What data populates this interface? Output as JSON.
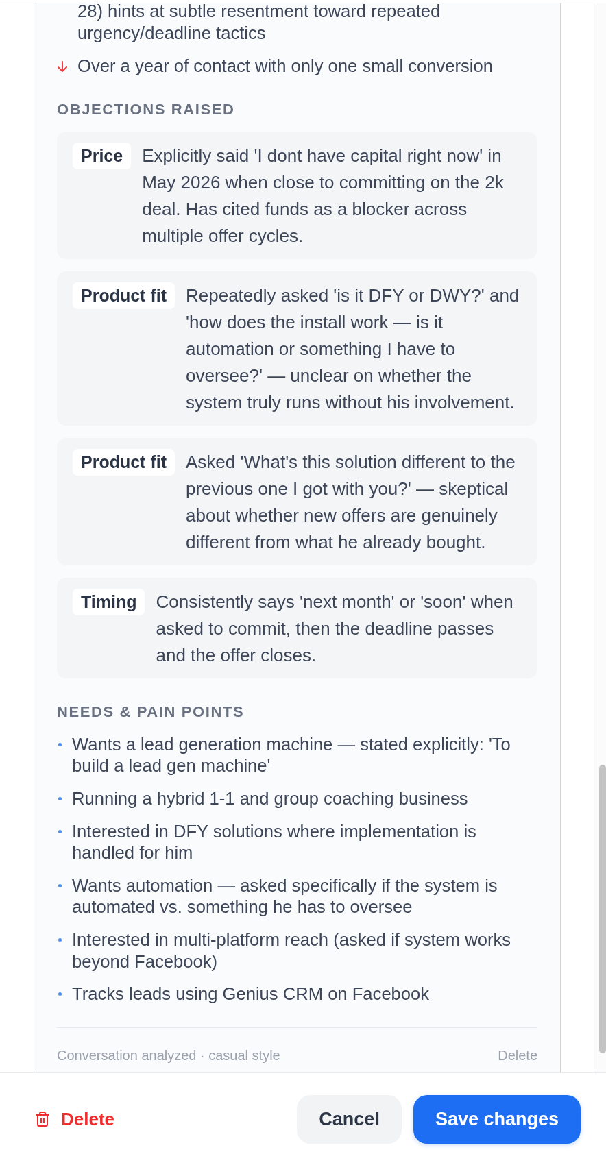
{
  "signals": [
    {
      "kind": "continued",
      "text": "28) hints at subtle resentment toward repeated urgency/deadline tactics"
    },
    {
      "kind": "negative",
      "text": "Over a year of contact with only one small conversion"
    }
  ],
  "objections": {
    "heading": "OBJECTIONS RAISED",
    "items": [
      {
        "label": "Price",
        "text": "Explicitly said 'I dont have capital right now' in May 2026 when close to committing on the 2k deal. Has cited funds as a blocker across multiple offer cycles."
      },
      {
        "label": "Product fit",
        "text": "Repeatedly asked 'is it DFY or DWY?' and 'how does the install work — is it automation or something I have to oversee?' — unclear on whether the system truly runs without his involvement."
      },
      {
        "label": "Product fit",
        "text": "Asked 'What's this solution different to the previous one I got with you?' — skeptical about whether new offers are genuinely different from what he already bought."
      },
      {
        "label": "Timing",
        "text": "Consistently says 'next month' or 'soon' when asked to commit, then the deadline passes and the offer closes."
      }
    ]
  },
  "needs": {
    "heading": "NEEDS & PAIN POINTS",
    "items": [
      "Wants a lead generation machine — stated explicitly: 'To build a lead gen machine'",
      "Running a hybrid 1-1 and group coaching business",
      "Interested in DFY solutions where implementation is handled for him",
      "Wants automation — asked specifically if the system is automated vs. something he has to oversee",
      "Interested in multi-platform reach (asked if system works beyond Facebook)",
      "Tracks leads using Genius CRM on Facebook"
    ]
  },
  "card_footer": {
    "summary": "Conversation analyzed · casual style",
    "delete": "Delete"
  },
  "actions": {
    "delete": "Delete",
    "cancel": "Cancel",
    "save": "Save changes"
  }
}
